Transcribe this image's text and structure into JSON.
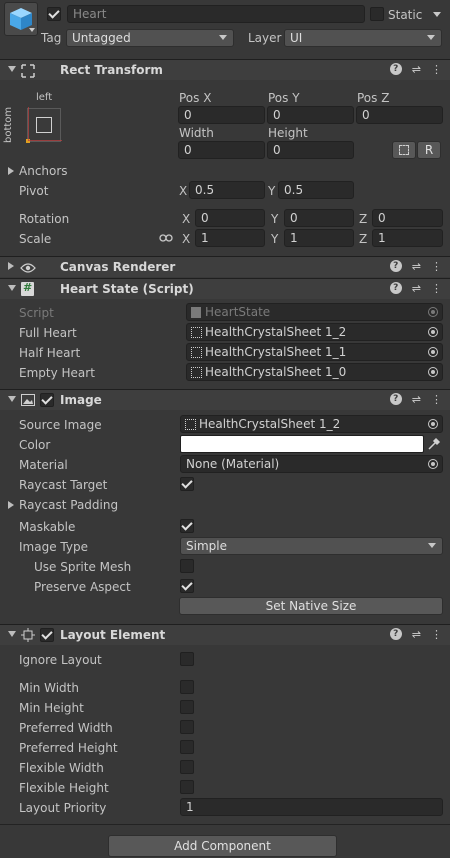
{
  "header": {
    "object_name": "Heart",
    "static_label": "Static",
    "tag_label": "Tag",
    "tag_value": "Untagged",
    "layer_label": "Layer",
    "layer_value": "UI"
  },
  "rect_transform": {
    "title": "Rect Transform",
    "anchor_h": "left",
    "anchor_v": "bottom",
    "pos_x_label": "Pos X",
    "pos_y_label": "Pos Y",
    "pos_z_label": "Pos Z",
    "pos_x": "0",
    "pos_y": "0",
    "pos_z": "0",
    "width_label": "Width",
    "height_label": "Height",
    "width": "0",
    "height": "0",
    "raw_button": "R",
    "anchors_label": "Anchors",
    "pivot_label": "Pivot",
    "pivot_x_label": "X",
    "pivot_x": "0.5",
    "pivot_y_label": "Y",
    "pivot_y": "0.5",
    "rotation_label": "Rotation",
    "rot_x_label": "X",
    "rot_x": "0",
    "rot_y_label": "Y",
    "rot_y": "0",
    "rot_z_label": "Z",
    "rot_z": "0",
    "scale_label": "Scale",
    "scale_x_label": "X",
    "scale_x": "1",
    "scale_y_label": "Y",
    "scale_y": "1",
    "scale_z_label": "Z",
    "scale_z": "1"
  },
  "canvas_renderer": {
    "title": "Canvas Renderer"
  },
  "heart_state": {
    "title": "Heart State (Script)",
    "script_label": "Script",
    "script_value": "HeartState",
    "full_label": "Full Heart",
    "full_value": "HealthCrystalSheet 1_2",
    "half_label": "Half Heart",
    "half_value": "HealthCrystalSheet 1_1",
    "empty_label": "Empty Heart",
    "empty_value": "HealthCrystalSheet 1_0"
  },
  "image": {
    "title": "Image",
    "source_label": "Source Image",
    "source_value": "HealthCrystalSheet 1_2",
    "color_label": "Color",
    "color_value": "#ffffff",
    "material_label": "Material",
    "material_value": "None (Material)",
    "raycast_target_label": "Raycast Target",
    "raycast_padding_label": "Raycast Padding",
    "maskable_label": "Maskable",
    "image_type_label": "Image Type",
    "image_type_value": "Simple",
    "use_sprite_mesh_label": "Use Sprite Mesh",
    "preserve_aspect_label": "Preserve Aspect",
    "set_native_size": "Set Native Size"
  },
  "layout_element": {
    "title": "Layout Element",
    "ignore_layout_label": "Ignore Layout",
    "min_width_label": "Min Width",
    "min_height_label": "Min Height",
    "preferred_width_label": "Preferred Width",
    "preferred_height_label": "Preferred Height",
    "flexible_width_label": "Flexible Width",
    "flexible_height_label": "Flexible Height",
    "layout_priority_label": "Layout Priority",
    "layout_priority_value": "1"
  },
  "add_component": "Add Component",
  "colors": {
    "accent": "#4aa8e8",
    "panel": "#383838",
    "header": "#3e3e3e"
  }
}
